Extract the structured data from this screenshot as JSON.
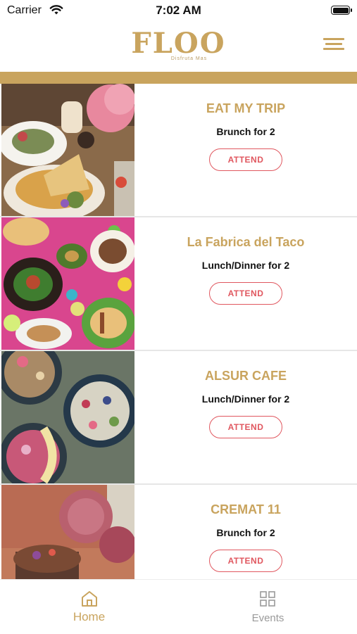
{
  "status_bar": {
    "carrier": "Carrier",
    "time": "7:02 AM"
  },
  "header": {
    "logo_text": "FLOO",
    "logo_tagline": "Disfruta Mas"
  },
  "events": [
    {
      "name": "EAT MY TRIP",
      "meal": "Brunch for 2",
      "action": "ATTEND",
      "image": "brunch-table-photo"
    },
    {
      "name": "La Fabrica del Taco",
      "meal": "Lunch/Dinner for 2",
      "action": "ATTEND",
      "image": "tacos-photo"
    },
    {
      "name": "ALSUR CAFE",
      "meal": "Lunch/Dinner for 2",
      "action": "ATTEND",
      "image": "acai-bowls-photo"
    },
    {
      "name": "CREMAT 11",
      "meal": "Brunch for 2",
      "action": "ATTEND",
      "image": "pancakes-flowers-photo"
    }
  ],
  "tabbar": {
    "home_label": "Home",
    "events_label": "Events",
    "active": "Home"
  },
  "colors": {
    "brand_gold": "#c9a45e",
    "attend_red": "#e0575f",
    "inactive": "#9a9a9a"
  }
}
